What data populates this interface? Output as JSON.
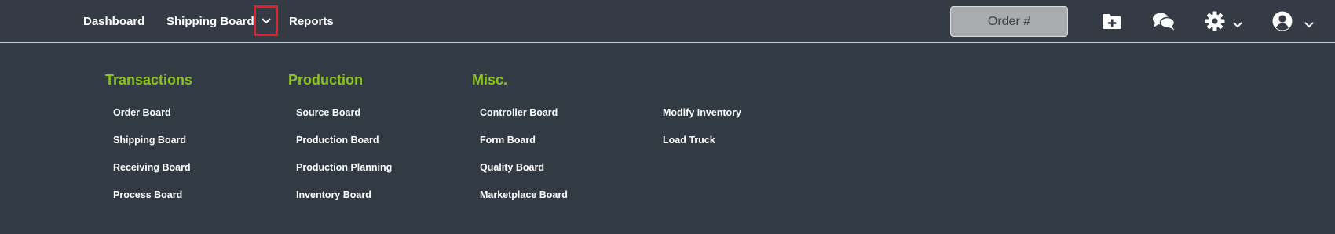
{
  "nav": {
    "dashboard": "Dashboard",
    "shipping_board": "Shipping Board",
    "reports": "Reports"
  },
  "search": {
    "placeholder": "Order #"
  },
  "icons": {
    "add_folder": "folder-plus-icon",
    "chat": "comments-icon",
    "settings": "gear-icon",
    "user": "user-circle-icon"
  },
  "colors": {
    "background": "#323a43",
    "heading_accent": "#8dc21f",
    "highlight_border": "#e0202a"
  },
  "menu": {
    "transactions": {
      "heading": "Transactions",
      "items": [
        "Order Board",
        "Shipping Board",
        "Receiving Board",
        "Process Board"
      ]
    },
    "production": {
      "heading": "Production",
      "items": [
        "Source Board",
        "Production Board",
        "Production Planning",
        "Inventory Board"
      ]
    },
    "misc": {
      "heading": "Misc.",
      "items": [
        "Controller Board",
        "Form Board",
        "Quality Board",
        "Marketplace Board"
      ]
    },
    "misc_extra": {
      "items": [
        "Modify Inventory",
        "Load Truck"
      ]
    }
  }
}
